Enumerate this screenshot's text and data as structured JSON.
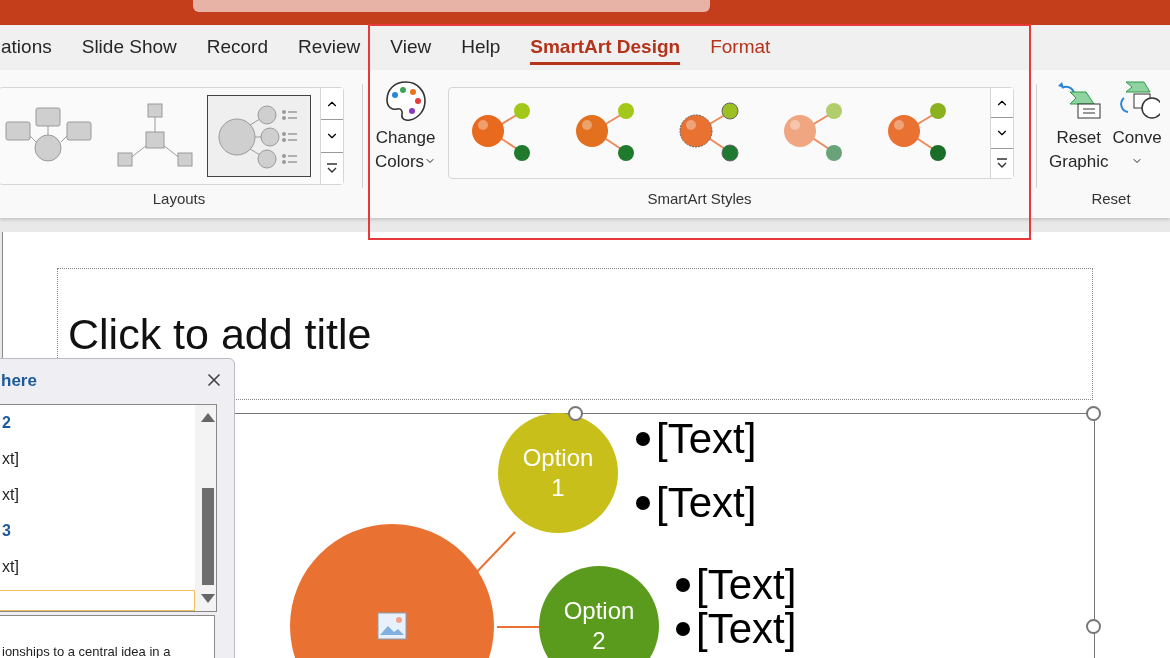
{
  "tabs": [
    {
      "label": "ations",
      "selected": false,
      "contextual": false
    },
    {
      "label": "Slide Show",
      "selected": false,
      "contextual": false
    },
    {
      "label": "Record",
      "selected": false,
      "contextual": false
    },
    {
      "label": "Review",
      "selected": false,
      "contextual": false
    },
    {
      "label": "View",
      "selected": false,
      "contextual": false
    },
    {
      "label": "Help",
      "selected": false,
      "contextual": false
    },
    {
      "label": "SmartArt Design",
      "selected": true,
      "contextual": true
    },
    {
      "label": "Format",
      "selected": false,
      "contextual": true
    }
  ],
  "layouts": {
    "label": "Layouts",
    "items": [
      {
        "kind": "converging",
        "selected": false
      },
      {
        "kind": "hub",
        "selected": false
      },
      {
        "kind": "picture-list",
        "selected": true
      }
    ]
  },
  "styles": {
    "label": "SmartArt Styles",
    "change_colors": "Change Colors"
  },
  "reset": {
    "label": "Reset",
    "buttons": [
      {
        "kind": "reset",
        "label": "Reset Graphic"
      },
      {
        "kind": "convert",
        "label": "Conve"
      }
    ]
  },
  "slide": {
    "title_placeholder": "Click to add title",
    "center": {
      "color": "#e97132"
    },
    "nodes": [
      {
        "label": "Option 1",
        "color": "#c9bf1b",
        "bullets": [
          "[Text]",
          "[Text]"
        ]
      },
      {
        "label": "Option 2",
        "color": "#5a9a1d",
        "bullets": [
          "[Text]",
          "[Text]"
        ]
      }
    ]
  },
  "text_pane": {
    "title": "here",
    "lines": [
      {
        "kind": "heading",
        "text": "2"
      },
      {
        "kind": "bullet",
        "text": "xt]"
      },
      {
        "kind": "bullet",
        "text": "xt]"
      },
      {
        "kind": "heading",
        "text": "3"
      },
      {
        "kind": "bullet",
        "text": "xt]"
      }
    ],
    "description": "ionships to a central idea in a"
  }
}
